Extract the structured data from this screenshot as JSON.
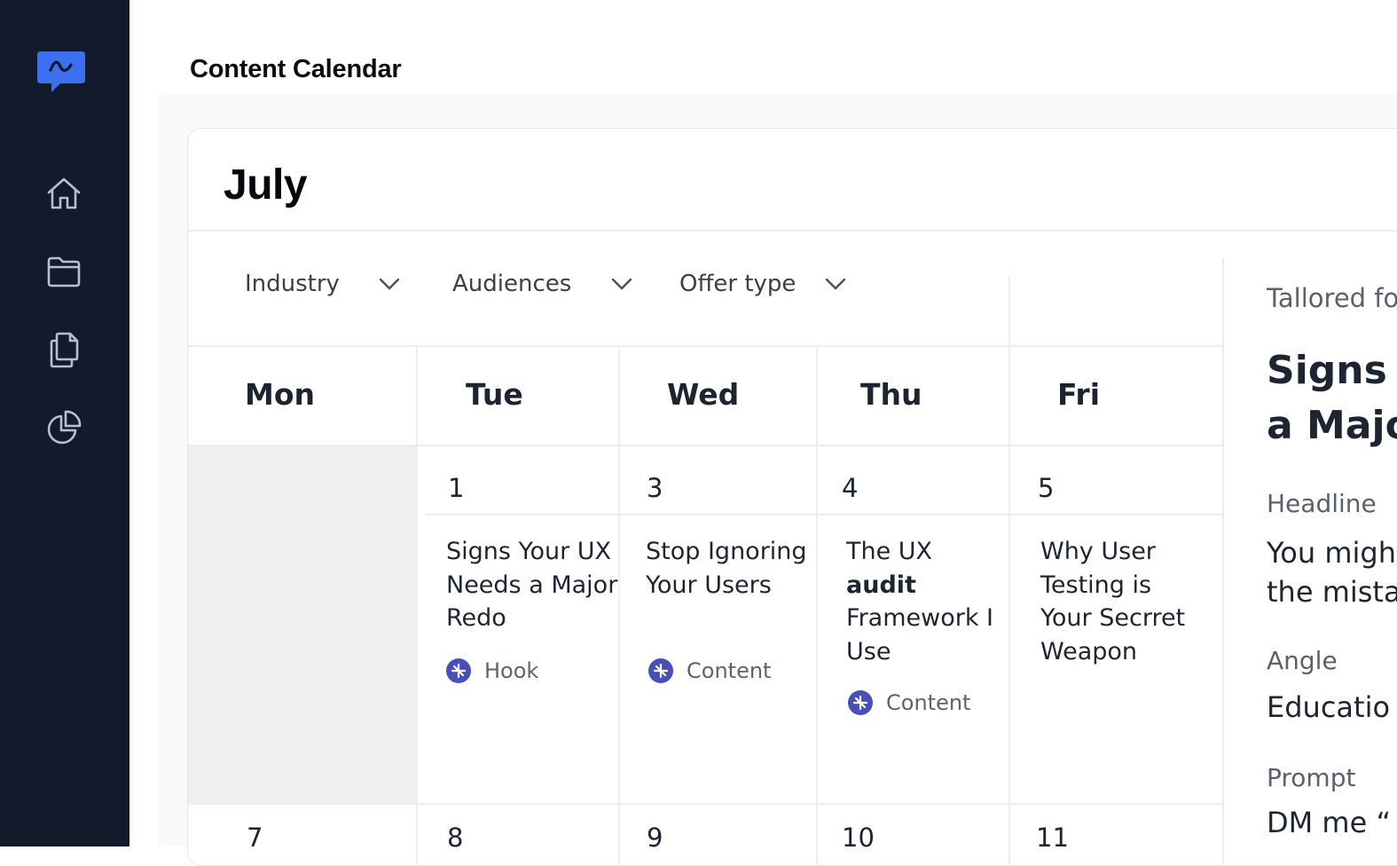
{
  "page": {
    "title": "Content Calendar"
  },
  "sidebar": {
    "logo": "chat-bubble-logo",
    "items": [
      {
        "icon": "home-icon"
      },
      {
        "icon": "folder-icon"
      },
      {
        "icon": "documents-icon"
      },
      {
        "icon": "pie-chart-icon"
      }
    ]
  },
  "calendar": {
    "month": "July",
    "filters": [
      {
        "label": "Industry"
      },
      {
        "label": "Audiences"
      },
      {
        "label": "Offer type"
      }
    ],
    "days": [
      "Mon",
      "Tue",
      "Wed",
      "Thu",
      "Fri"
    ],
    "week1": [
      {
        "date": ""
      },
      {
        "date": "1",
        "title": "Signs Your UX Needs a Major Redo",
        "tag": "Hook"
      },
      {
        "date": "3",
        "title": "Stop Ignoring Your Users",
        "tag": "Content"
      },
      {
        "date": "4",
        "title_before": "The UX",
        "title_bold": "audit",
        "title_after": "Framework I Use",
        "tag": "Content"
      },
      {
        "date": "5",
        "title": "Why User Testing is Your Secrret Weapon"
      }
    ],
    "week2": [
      "7",
      "8",
      "9",
      "10",
      "11"
    ]
  },
  "detail_panel": {
    "subtitle": "Tallored fo",
    "title_line1": "Signs Y",
    "title_line2": "a Majo",
    "headline_label": "Headline",
    "headline_line1": "You migh",
    "headline_line2": "the mista",
    "angle_label": "Angle",
    "angle_value": "Educatio",
    "prompt_label": "Prompt",
    "prompt_value": "DM me “"
  },
  "colors": {
    "sidebar_bg": "#131a2b",
    "accent": "#3d6ff2",
    "badge": "#4a4fb8",
    "empty_cell": "#efefef"
  }
}
